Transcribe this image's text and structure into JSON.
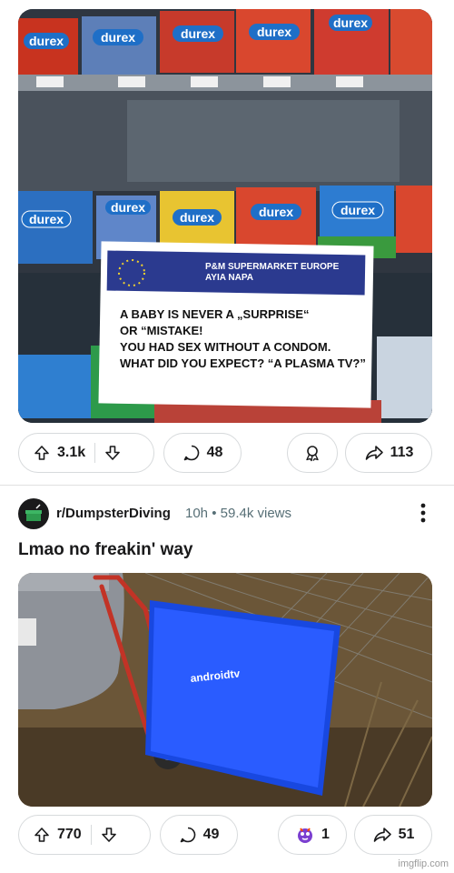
{
  "post1": {
    "image": {
      "sign_header_line1": "P&M SUPERMARKET EUROPE",
      "sign_header_line2": "AYIA NAPA",
      "sign_lines": [
        "A BABY IS NEVER A „SURPRISE“",
        "OR “MISTAKE!",
        "YOU HAD SEX WITHOUT A CONDOM.",
        "WHAT DID YOU EXPECT? “A PLASMA TV?”"
      ],
      "brand": "durex"
    },
    "actions": {
      "upvotes": "3.1k",
      "comments": "48",
      "shares": "113"
    }
  },
  "post2": {
    "subreddit": "r/DumpsterDiving",
    "age": "10h",
    "separator": "•",
    "views": "59.4k views",
    "title": "Lmao no freakin' way",
    "image": {
      "tv_logo": "androidtv"
    },
    "actions": {
      "upvotes": "770",
      "comments": "49",
      "awards": "1",
      "shares": "51"
    }
  },
  "watermark": "imgflip.com",
  "icons": {
    "upvote": "arrow-up-icon",
    "downvote": "arrow-down-icon",
    "comment": "comment-bubble-icon",
    "award": "award-icon",
    "share": "share-arrow-icon",
    "more": "more-vertical-icon"
  },
  "colors": {
    "text": "#1a1a1b",
    "meta": "#576f76",
    "border": "#d7dadc",
    "sign_blue": "#2b3a8f",
    "durex_blue": "#1f6fc7"
  }
}
